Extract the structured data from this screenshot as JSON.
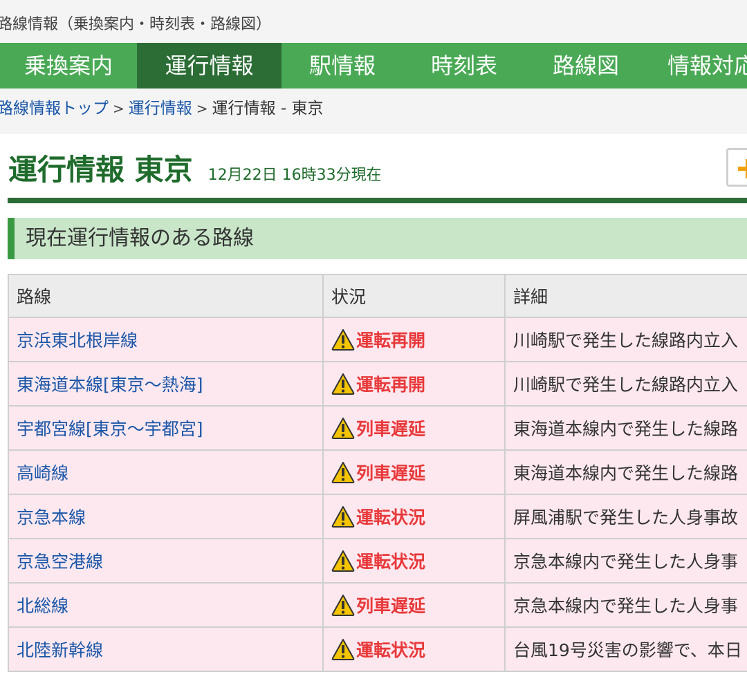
{
  "page": {
    "top_title": "路線情報（乗換案内・時刻表・路線図）",
    "nav": [
      {
        "label": "乗換案内",
        "active": false
      },
      {
        "label": "運行情報",
        "active": true
      },
      {
        "label": "駅情報",
        "active": false
      },
      {
        "label": "時刻表",
        "active": false
      },
      {
        "label": "路線図",
        "active": false
      },
      {
        "label": "情報対応",
        "active": false
      }
    ],
    "breadcrumb": {
      "top": "路線情報トップ",
      "sep": ">",
      "middle": "運行情報",
      "current": "運行情報 - 東京"
    },
    "title": "運行情報 東京",
    "timestamp": "12月22日 16時33分現在",
    "section_heading": "現在運行情報のある路線"
  },
  "table": {
    "headers": [
      "路線",
      "状況",
      "詳細"
    ],
    "rows": [
      {
        "line": "京浜東北根岸線",
        "status": "運転再開",
        "detail": "川崎駅で発生した線路内立入"
      },
      {
        "line": "東海道本線[東京～熱海]",
        "status": "運転再開",
        "detail": "川崎駅で発生した線路内立入"
      },
      {
        "line": "宇都宮線[東京～宇都宮]",
        "status": "列車遅延",
        "detail": "東海道本線内で発生した線路"
      },
      {
        "line": "高崎線",
        "status": "列車遅延",
        "detail": "東海道本線内で発生した線路"
      },
      {
        "line": "京急本線",
        "status": "運転状況",
        "detail": "屏風浦駅で発生した人身事故"
      },
      {
        "line": "京急空港線",
        "status": "運転状況",
        "detail": "京急本線内で発生した人身事"
      },
      {
        "line": "北総線",
        "status": "列車遅延",
        "detail": "京急本線内で発生した人身事"
      },
      {
        "line": "北陸新幹線",
        "status": "運転状況",
        "detail": "台風19号災害の影響で、本日"
      }
    ]
  },
  "colors": {
    "nav_bg": "#4aa955",
    "nav_active": "#2b6d35",
    "title_green": "#1f6b2c",
    "status_red": "#e8393a",
    "row_pink": "#fde8ef",
    "link_blue": "#1a56a8"
  },
  "icons": {
    "status_icon": "warning-triangle-icon",
    "expand_icon": "plus-icon"
  }
}
